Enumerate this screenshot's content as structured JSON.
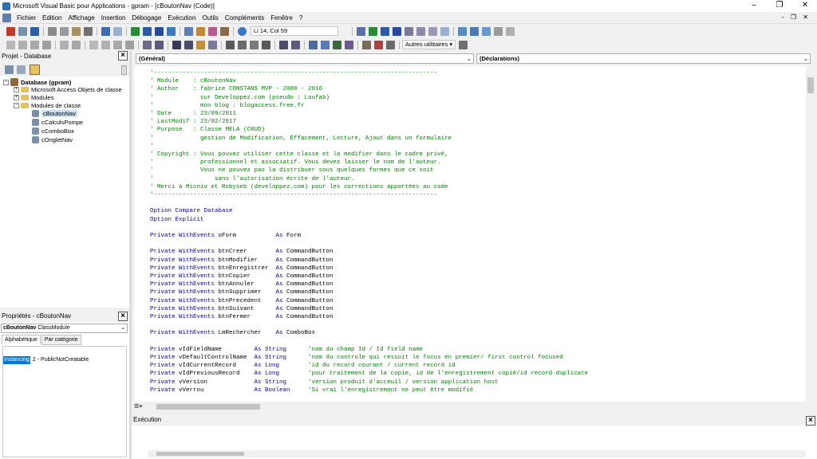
{
  "window": {
    "title": "Microsoft Visual Basic pour Applications - gpram - [cBoutonNav (Code)]",
    "minimize": "–",
    "restore": "❐",
    "close": "✕"
  },
  "menu": {
    "items": [
      "Fichier",
      "Edition",
      "Affichage",
      "Insertion",
      "Débogage",
      "Exécution",
      "Outils",
      "Compléments",
      "Fenêtre",
      "?"
    ],
    "mdi_controls": "- ❐ ✕"
  },
  "toolbar": {
    "position": "Li 14, Col 59",
    "utilities_label": "Autres utilitaires ▾"
  },
  "project_pane": {
    "title": "Projet - Database",
    "tree": {
      "root": "Database (gpram)",
      "access_objects": "Microsoft Access Objets de classe",
      "modules": "Modules",
      "class_modules": "Modules de classe",
      "classes": [
        "cBoutonNav",
        "cCalculsPompe",
        "cComboBox",
        "cOngletNav"
      ]
    }
  },
  "properties_pane": {
    "title": "Propriétés - cBoutonNav",
    "object_selector_name": "cBoutonNav",
    "object_selector_type": "ClassModule",
    "tabs": [
      "Alphabétique",
      "Par catégorie"
    ],
    "property_name": "Instancing",
    "property_value": "2 - PublicNotCreatable"
  },
  "editor": {
    "object_combo": "(Général)",
    "proc_combo": "(Déclarations)",
    "lines": [
      {
        "cls": "cm",
        "text": "'-------------------------------------------------------------------------------"
      },
      {
        "cls": "cm",
        "text": "' Module    : cBoutonNav"
      },
      {
        "cls": "cm",
        "text": "' Author    : fabrice CONSTANS MVP - 2008 - 2016"
      },
      {
        "cls": "cm",
        "text": "'             sur Developpez.com (pseudo : Loufab)"
      },
      {
        "cls": "cm",
        "text": "'             mon blog : blogaccess.free.fr"
      },
      {
        "cls": "cm",
        "text": "' Date      : 23/09/2011"
      },
      {
        "cls": "cm",
        "text": "' LastModif : 23/02/2017"
      },
      {
        "cls": "cm",
        "text": "' Purpose   : Classe MELA (CRUD)"
      },
      {
        "cls": "cm",
        "text": "'             gestion de Modification, Effacement, Lecture, Ajout dans un formulaire"
      },
      {
        "cls": "cm",
        "text": "'"
      },
      {
        "cls": "cm",
        "text": "' Copyright : Vous pouvez utiliser cette classe et la modifier dans le cadre privé,"
      },
      {
        "cls": "cm",
        "text": "'             professionnel et associatif. Vous devez laisser le nom de l'auteur."
      },
      {
        "cls": "cm",
        "text": "'             Vous ne pouvez pas la distribuer sous quelques formes que ce soit"
      },
      {
        "cls": "cm",
        "text": "'                 sans l'autorisation écrite de l'auteur."
      },
      {
        "cls": "cm",
        "text": "' Merci à Micniv et Robyseb (developpez.com) pour les corrections apportées au code"
      },
      {
        "cls": "cm",
        "text": "'-------------------------------------------------------------------------------"
      },
      {
        "cls": "tx",
        "text": ""
      },
      {
        "cls": "kw",
        "text": "Option Compare Database"
      },
      {
        "cls": "kw",
        "text": "Option Explicit"
      },
      {
        "cls": "tx",
        "text": ""
      },
      {
        "cls": "mx",
        "kw": "Private WithEvents ",
        "tx": "oForm           ",
        "kw2": "As ",
        "tx2": "Form"
      },
      {
        "cls": "tx",
        "text": ""
      },
      {
        "cls": "mx",
        "kw": "Private WithEvents ",
        "tx": "btnCreer        ",
        "kw2": "As ",
        "tx2": "CommandButton"
      },
      {
        "cls": "mx",
        "kw": "Private WithEvents ",
        "tx": "btnModifier     ",
        "kw2": "As ",
        "tx2": "CommandButton"
      },
      {
        "cls": "mx",
        "kw": "Private WithEvents ",
        "tx": "btnEnregistrer  ",
        "kw2": "As ",
        "tx2": "CommandButton"
      },
      {
        "cls": "mx",
        "kw": "Private WithEvents ",
        "tx": "btnCopier       ",
        "kw2": "As ",
        "tx2": "CommandButton"
      },
      {
        "cls": "mx",
        "kw": "Private WithEvents ",
        "tx": "btnAnnuler      ",
        "kw2": "As ",
        "tx2": "CommandButton"
      },
      {
        "cls": "mx",
        "kw": "Private WithEvents ",
        "tx": "btnSupprimer    ",
        "kw2": "As ",
        "tx2": "CommandButton"
      },
      {
        "cls": "mx",
        "kw": "Private WithEvents ",
        "tx": "btnPrecedent    ",
        "kw2": "As ",
        "tx2": "CommandButton"
      },
      {
        "cls": "mx",
        "kw": "Private WithEvents ",
        "tx": "btnSuivant      ",
        "kw2": "As ",
        "tx2": "CommandButton"
      },
      {
        "cls": "mx",
        "kw": "Private WithEvents ",
        "tx": "btnFermer       ",
        "kw2": "As ",
        "tx2": "CommandButton"
      },
      {
        "cls": "tx",
        "text": ""
      },
      {
        "cls": "mx",
        "kw": "Private WithEvents ",
        "tx": "LmRechercher    ",
        "kw2": "As ",
        "tx2": "ComboBox"
      },
      {
        "cls": "tx",
        "text": ""
      },
      {
        "cls": "vr",
        "kw": "Private ",
        "tx": "vIdFieldName         ",
        "kw2": "As String      ",
        "cm": "'nom du champ Id / Id field name"
      },
      {
        "cls": "vr",
        "kw": "Private ",
        "tx": "vDefaultControlName  ",
        "kw2": "As String      ",
        "cm": "'nom du controle qui ressoit le focus en premier/ first control focused"
      },
      {
        "cls": "vr",
        "kw": "Private ",
        "tx": "vIdCurrentRecord     ",
        "kw2": "As Long        ",
        "cm": "'id du record courant / current record id"
      },
      {
        "cls": "vr",
        "kw": "Private ",
        "tx": "vIdPreviousRecord    ",
        "kw2": "As Long        ",
        "cm": "'pour traitement de la copie, id de l'enregistrement copié/id record duplicate"
      },
      {
        "cls": "vr",
        "kw": "Private ",
        "tx": "vVersion             ",
        "kw2": "As String      ",
        "cm": "'version produit d'acceuil / version application host"
      },
      {
        "cls": "vr",
        "kw": "Private ",
        "tx": "vVerrou              ",
        "kw2": "As Boolean     ",
        "cm": "'Si vrai l'enregistrement ne peut être modifié"
      }
    ]
  },
  "execution_pane": {
    "title": "Exécution"
  },
  "colors": {
    "comment": "#008000",
    "keyword": "#00008b",
    "selection": "#0078d7"
  }
}
